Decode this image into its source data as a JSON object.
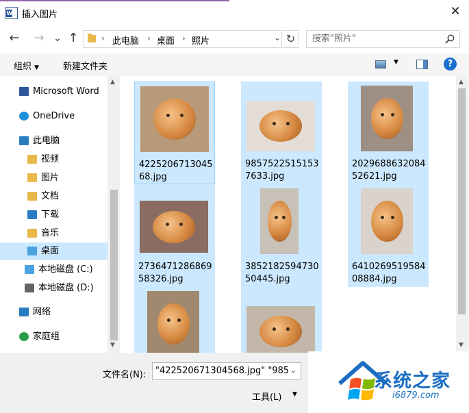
{
  "window": {
    "title": "插入图片",
    "close_glyph": "✕"
  },
  "nav": {
    "back_glyph": "←",
    "forward_glyph": "→",
    "recent_glyph": "⌄",
    "up_glyph": "↑",
    "address": [
      "此电脑",
      "桌面",
      "照片"
    ],
    "address_sep": "›",
    "refresh_glyph": "↻",
    "search_placeholder": "搜索\"照片\""
  },
  "toolbar": {
    "organize_label": "组织",
    "organize_caret": "▼",
    "new_folder_label": "新建文件夹",
    "view_caret": "▼",
    "help_glyph": "?"
  },
  "sidebar": {
    "items": [
      {
        "label": "Microsoft Word",
        "icon": "word-icon",
        "color": "#2b579a"
      },
      {
        "label": "OneDrive",
        "icon": "onedrive-icon",
        "color": "#1e8fd6"
      },
      {
        "label": "此电脑",
        "icon": "pc-icon",
        "color": "#2a7bc2"
      },
      {
        "label": "视频",
        "icon": "videos-folder-icon",
        "color": "#e8b84b"
      },
      {
        "label": "图片",
        "icon": "pictures-folder-icon",
        "color": "#e8b84b"
      },
      {
        "label": "文档",
        "icon": "documents-folder-icon",
        "color": "#e8b84b"
      },
      {
        "label": "下载",
        "icon": "downloads-folder-icon",
        "color": "#2a7bc2"
      },
      {
        "label": "音乐",
        "icon": "music-folder-icon",
        "color": "#e8b84b"
      },
      {
        "label": "桌面",
        "icon": "desktop-folder-icon",
        "color": "#4aa3e0",
        "selected": true
      },
      {
        "label": "本地磁盘 (C:)",
        "icon": "drive-c-icon",
        "color": "#4aa3e0"
      },
      {
        "label": "本地磁盘 (D:)",
        "icon": "drive-d-icon",
        "color": "#666666"
      },
      {
        "label": "网络",
        "icon": "network-icon",
        "color": "#2a7bc2"
      },
      {
        "label": "家庭组",
        "icon": "homegroup-icon",
        "color": "#2a9d4a"
      }
    ],
    "scroll_up": "▲",
    "scroll_down": "▼"
  },
  "files": [
    {
      "name": "422520671304568.jpg",
      "lines": [
        "4225206713045",
        "68.jpg"
      ]
    },
    {
      "name": "985752251515376 33.jpg",
      "lines": [
        "9857522515153",
        "7633.jpg"
      ]
    },
    {
      "name": "202968863208452621.jpg",
      "lines": [
        "2029688632084",
        "52621.jpg"
      ]
    },
    {
      "name": "273647128686958326.jpg",
      "lines": [
        "2736471286869",
        "58326.jpg"
      ]
    },
    {
      "name": "385218259473050445.jpg",
      "lines": [
        "3852182594730",
        "50445.jpg"
      ]
    },
    {
      "name": "641026951958408884.jpg",
      "lines": [
        "6410269519584",
        "08884.jpg"
      ]
    },
    {
      "name": "",
      "lines": [
        "",
        ""
      ]
    },
    {
      "name": "",
      "lines": [
        "",
        ""
      ]
    }
  ],
  "bottom": {
    "filename_label": "文件名(N):",
    "filename_value": "\"422520671304568.jpg\" \"985",
    "filename_drop": "⌄",
    "tools_label": "工具(L)",
    "tools_caret": "▼"
  },
  "watermark": {
    "title": "系统之家",
    "url": "i6879.com"
  }
}
